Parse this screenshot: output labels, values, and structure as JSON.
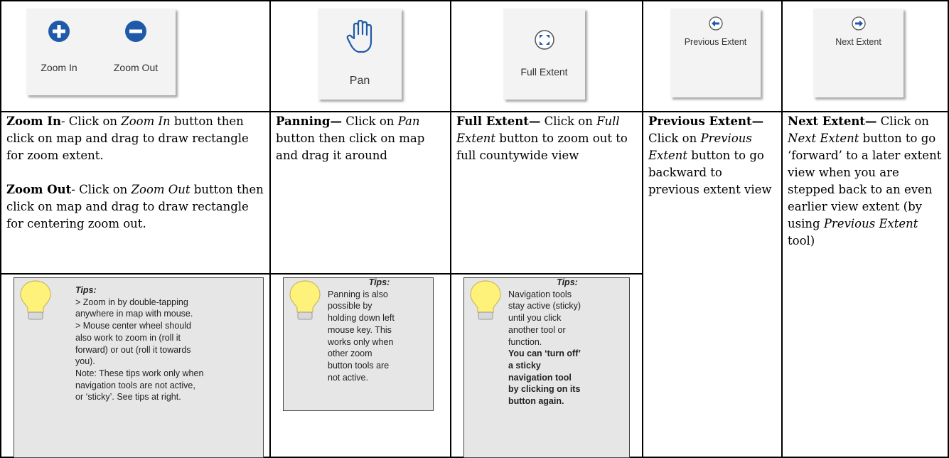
{
  "tools": {
    "zoom_in_label": "Zoom In",
    "zoom_out_label": "Zoom Out",
    "pan_label": "Pan",
    "full_extent_label": "Full Extent",
    "previous_extent_label": "Previous Extent",
    "next_extent_label": "Next Extent"
  },
  "descriptions": {
    "zoom_in": {
      "title": "Zoom In",
      "sep": "- Click on ",
      "tool": "Zoom In",
      "rest": " button then click on map and drag to draw rectangle for zoom extent."
    },
    "zoom_out": {
      "title": "Zoom Out",
      "sep": "- Click on ",
      "tool": "Zoom Out",
      "rest": " button then click on map and drag to draw rectangle for centering zoom out."
    },
    "pan": {
      "title": "Panning—",
      "sep": " Click on ",
      "tool": "Pan",
      "rest": " button then click on map and drag it around"
    },
    "full_extent": {
      "title": "Full Extent—",
      "sep": " Click on ",
      "tool": "Full Extent",
      "rest": " button to zoom out to full countywide view"
    },
    "previous_extent": {
      "title": "Previous Extent—",
      "sep": " Click on ",
      "tool": "Previous Extent",
      "rest": " button to go backward to previous extent view"
    },
    "next_extent": {
      "title": "Next  Extent—",
      "sep": " Click on ",
      "tool": "Next Extent",
      "rest": " button to go ‘forward’ to a later extent view when you are stepped back to an even earlier view extent (by using ",
      "tool2": "Previous Extent",
      "rest2": " tool)"
    }
  },
  "tips": {
    "zoom": {
      "title": "Tips:",
      "lines": [
        "> Zoom in by double-tapping",
        "anywhere in map with mouse.",
        "> Mouse center wheel should",
        "also work to zoom in (roll it",
        "forward) or out (roll it towards",
        "you).",
        "Note: These tips work only when",
        "navigation tools are not active,",
        "or ‘sticky’. See tips at right."
      ]
    },
    "pan": {
      "title": "Tips:",
      "lines": [
        "Panning is also",
        "possible by",
        "holding down left",
        "mouse key. This",
        "works only when",
        "other zoom",
        "button tools are",
        "not active."
      ]
    },
    "full_extent": {
      "title": "Tips:",
      "lines": [
        "Navigation tools",
        "stay active (sticky)",
        "until you click",
        "another tool or",
        "function."
      ],
      "bold_lines": [
        "You can ‘turn off’",
        "a sticky",
        "navigation tool",
        "by clicking on its",
        "button again."
      ]
    }
  },
  "colors": {
    "icon_blue": "#1e5aa8",
    "tip_bg": "#e6e6e6",
    "bulb_yellow": "#fff27a"
  }
}
